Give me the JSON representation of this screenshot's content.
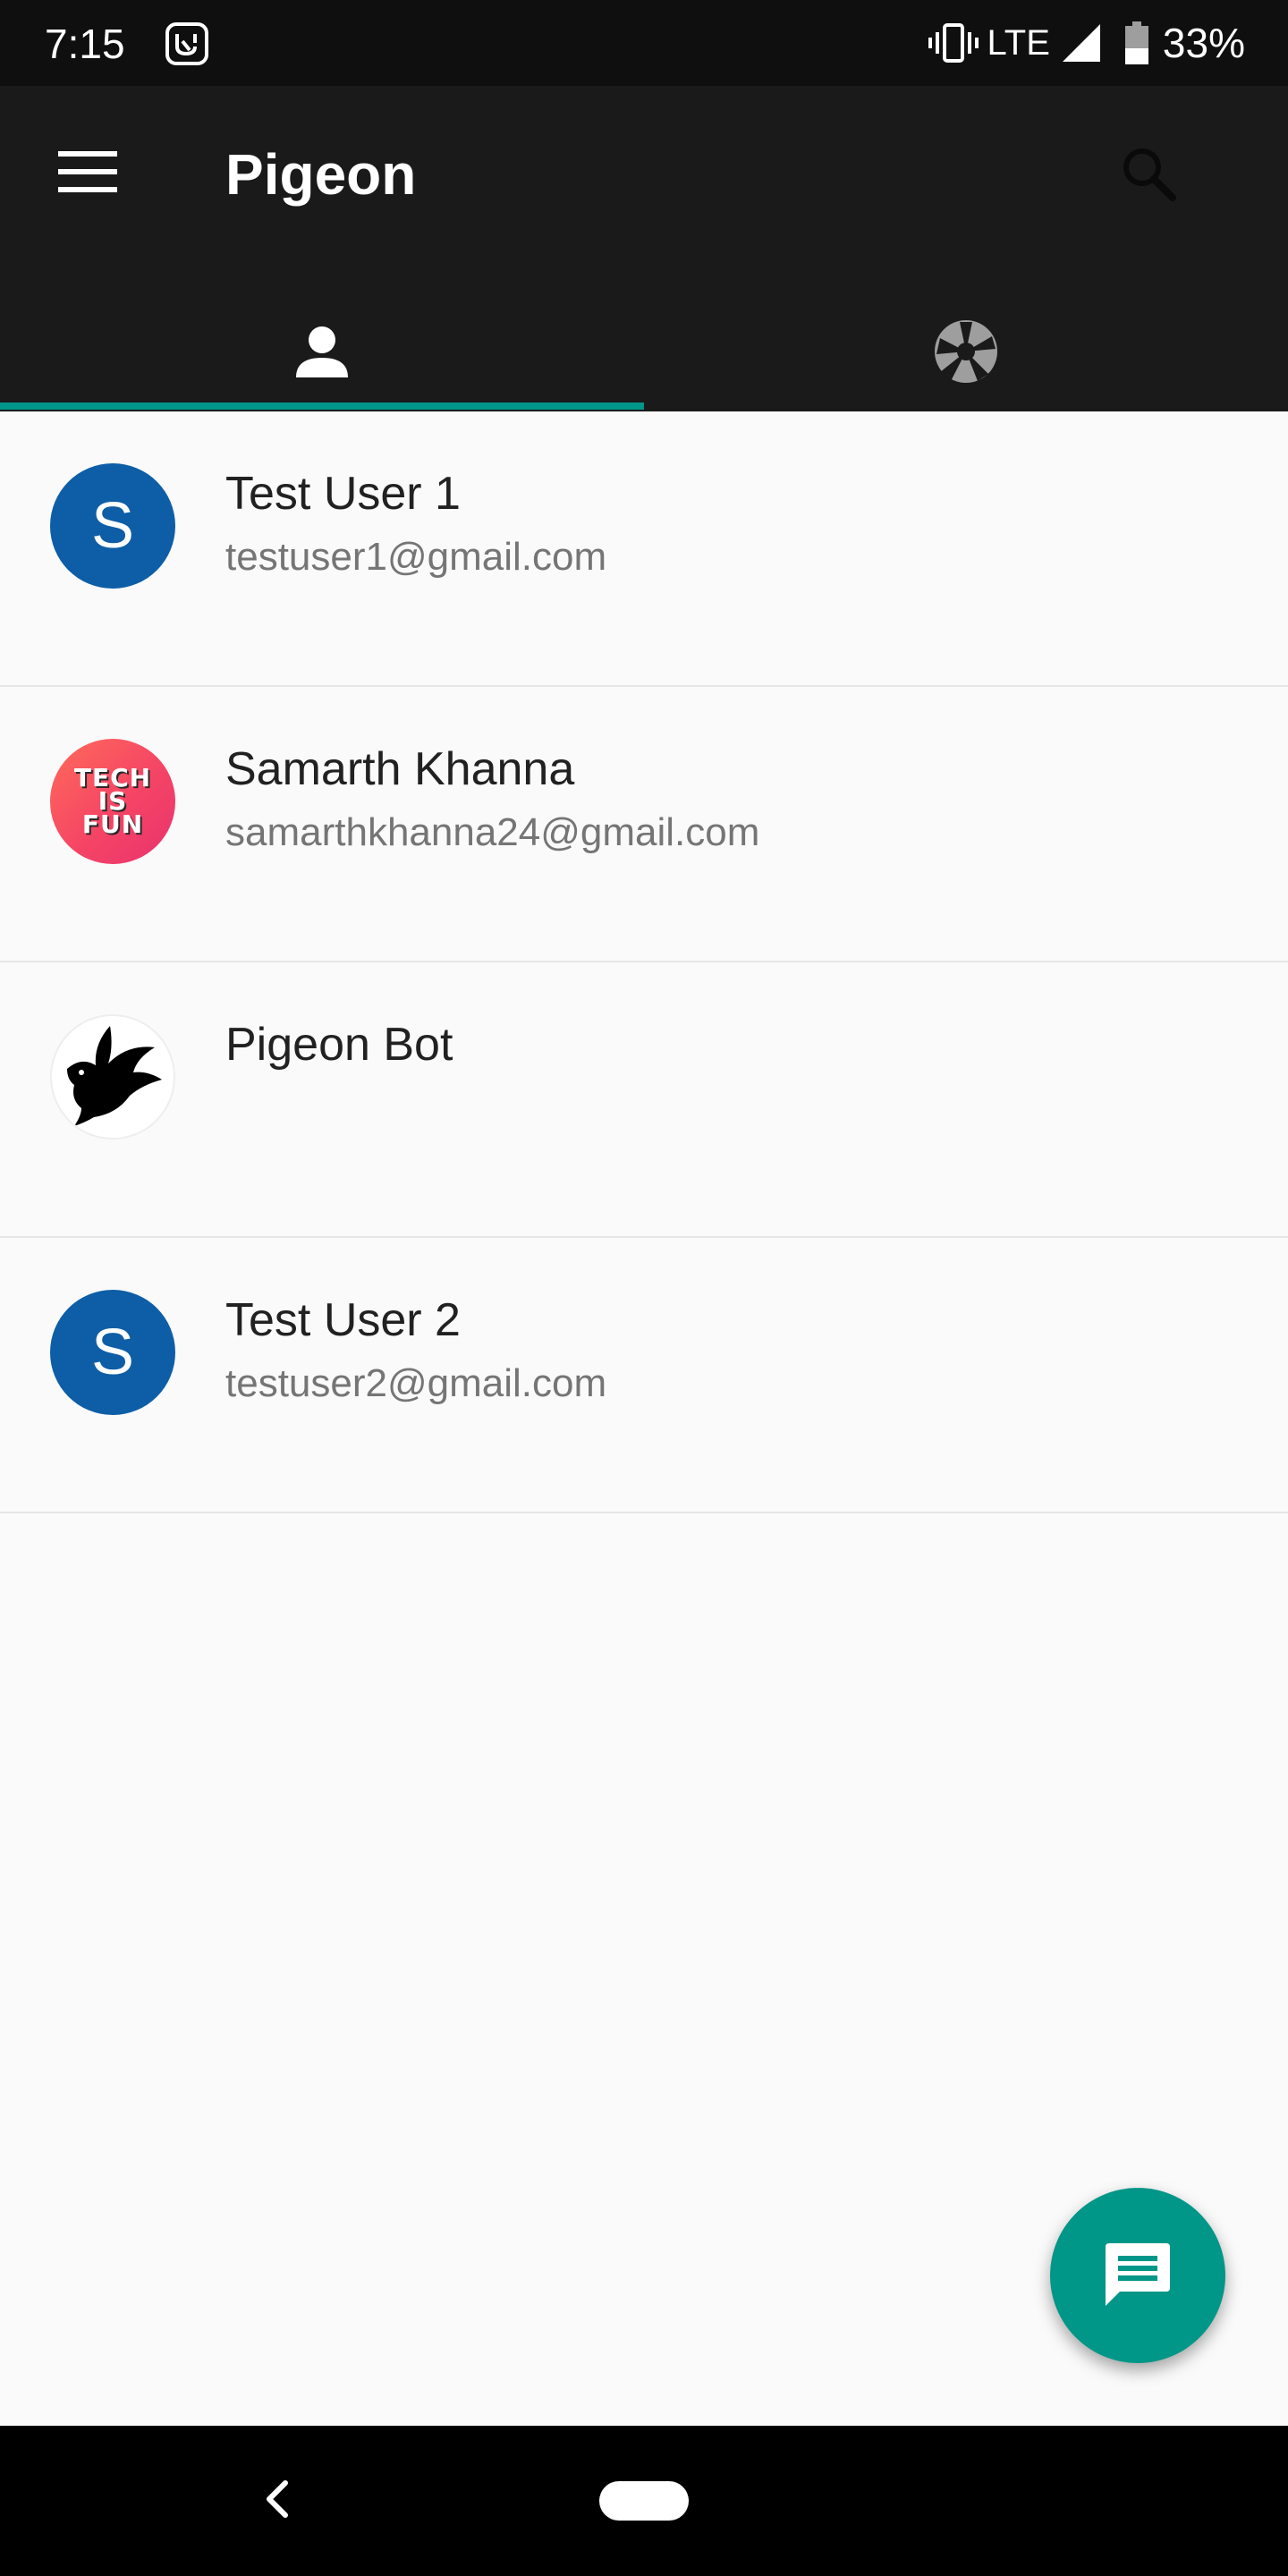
{
  "status_bar": {
    "time": "7:15",
    "network": "LTE",
    "battery": "33%",
    "app_icon": "music-app-icon",
    "icons": [
      "vibrate-icon",
      "signal-icon",
      "battery-icon"
    ]
  },
  "app_bar": {
    "title": "Pigeon",
    "menu_icon": "menu-icon",
    "search_icon": "search-icon",
    "tabs": [
      {
        "icon": "person-icon",
        "selected": true
      },
      {
        "icon": "camera-aperture-icon",
        "selected": false
      }
    ]
  },
  "contacts": [
    {
      "name": "Test User 1",
      "email": "testuser1@gmail.com",
      "avatar": "S"
    },
    {
      "name": "Samarth Khanna",
      "email": "samarthkhanna24@gmail.com",
      "avatar_text": [
        "TECH",
        "IS",
        "FUN"
      ]
    },
    {
      "name": "Pigeon Bot",
      "email": "",
      "avatar_icon": "pigeon-logo-icon"
    },
    {
      "name": "Test User 2",
      "email": "testuser2@gmail.com",
      "avatar": "S"
    }
  ],
  "fab": {
    "icon": "message-icon"
  },
  "colors": {
    "app_bar": "#1a1a1a",
    "accent": "#009688",
    "avatar_blue": "#0d5ea6",
    "background": "#fafafa"
  },
  "nav_bar": {
    "back_icon": "back-icon",
    "home_icon": "home-pill-icon"
  }
}
